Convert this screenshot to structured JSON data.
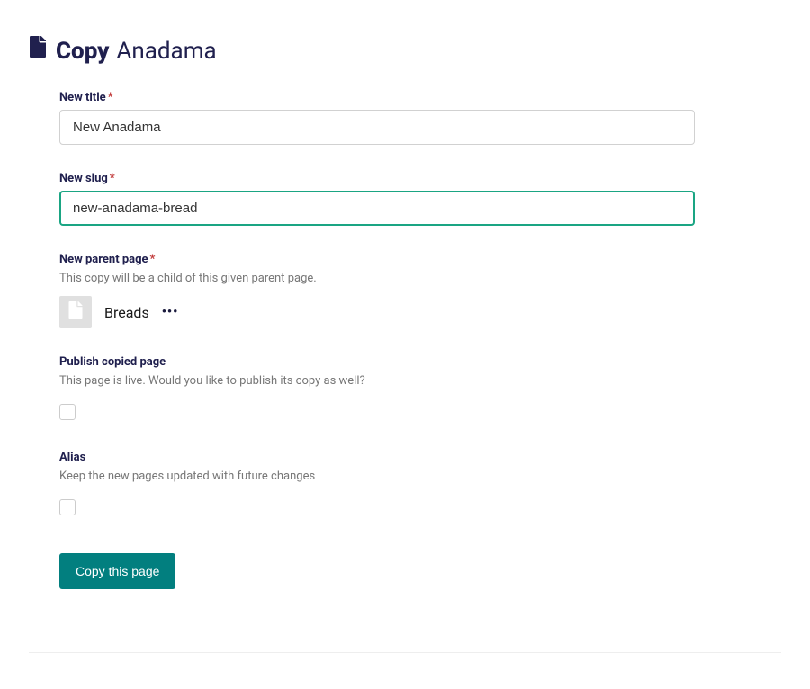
{
  "header": {
    "title_bold": "Copy",
    "title_light": "Anadama"
  },
  "fields": {
    "new_title": {
      "label": "New title",
      "value": "New Anadama"
    },
    "new_slug": {
      "label": "New slug",
      "value": "new-anadama-bread"
    },
    "new_parent": {
      "label": "New parent page",
      "help": "This copy will be a child of this given parent page.",
      "value": "Breads",
      "more": "•••"
    },
    "publish": {
      "label": "Publish copied page",
      "help": "This page is live. Would you like to publish its copy as well?"
    },
    "alias": {
      "label": "Alias",
      "help": "Keep the new pages updated with future changes"
    }
  },
  "submit_label": "Copy this page"
}
